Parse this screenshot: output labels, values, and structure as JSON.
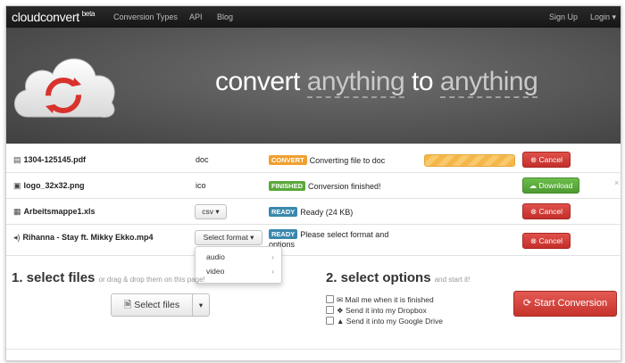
{
  "navbar": {
    "brand": "cloudconvert",
    "brand_suffix": "beta",
    "links": [
      "Conversion Types",
      "API",
      "Blog"
    ],
    "signup": "Sign Up",
    "login": "Login"
  },
  "hero": {
    "title_part1": "convert ",
    "title_part2": "anything",
    "title_part3": " to ",
    "title_part4": "anything"
  },
  "files": [
    {
      "name": "1304-125145.pdf",
      "type": "doc",
      "label": "CONVERT",
      "label_color": "#f0a030",
      "status": "Converting file to doc",
      "action": "Cancel",
      "progress": 1.0
    },
    {
      "name": "logo_32x32.png",
      "type": "ico",
      "label": "FINISHED",
      "label_color": "#5aa83a",
      "status": "Conversion finished!",
      "action": "Download"
    },
    {
      "name": "Arbeitsmappe1.xls",
      "type": "csv ▾",
      "label": "READY",
      "label_color": "#3a87ad",
      "status": "Ready (24 KB)",
      "action": "Cancel"
    },
    {
      "name": "Rihanna - Stay ft. Mikky Ekko.mp4",
      "type": "Select format ▾",
      "label": "READY",
      "label_color": "#3a87ad",
      "status": "Please select format and options",
      "action": "Cancel"
    }
  ],
  "dropdown": {
    "items": [
      "audio",
      "video"
    ]
  },
  "select_files": {
    "heading": "1. select files",
    "hint": "or drag & drop them on this page!",
    "button": "Select files"
  },
  "select_options": {
    "heading": "2. select options",
    "hint": "and start it!",
    "options": [
      "Mail me when it is finished",
      "Send it into my Dropbox",
      "Send it into my Google Drive"
    ],
    "start_button": "Start Conversion"
  },
  "colors": {
    "accent_red": "#c6332d",
    "accent_green": "#5aa83a",
    "accent_orange": "#f0a030",
    "accent_blue": "#3a87ad"
  }
}
